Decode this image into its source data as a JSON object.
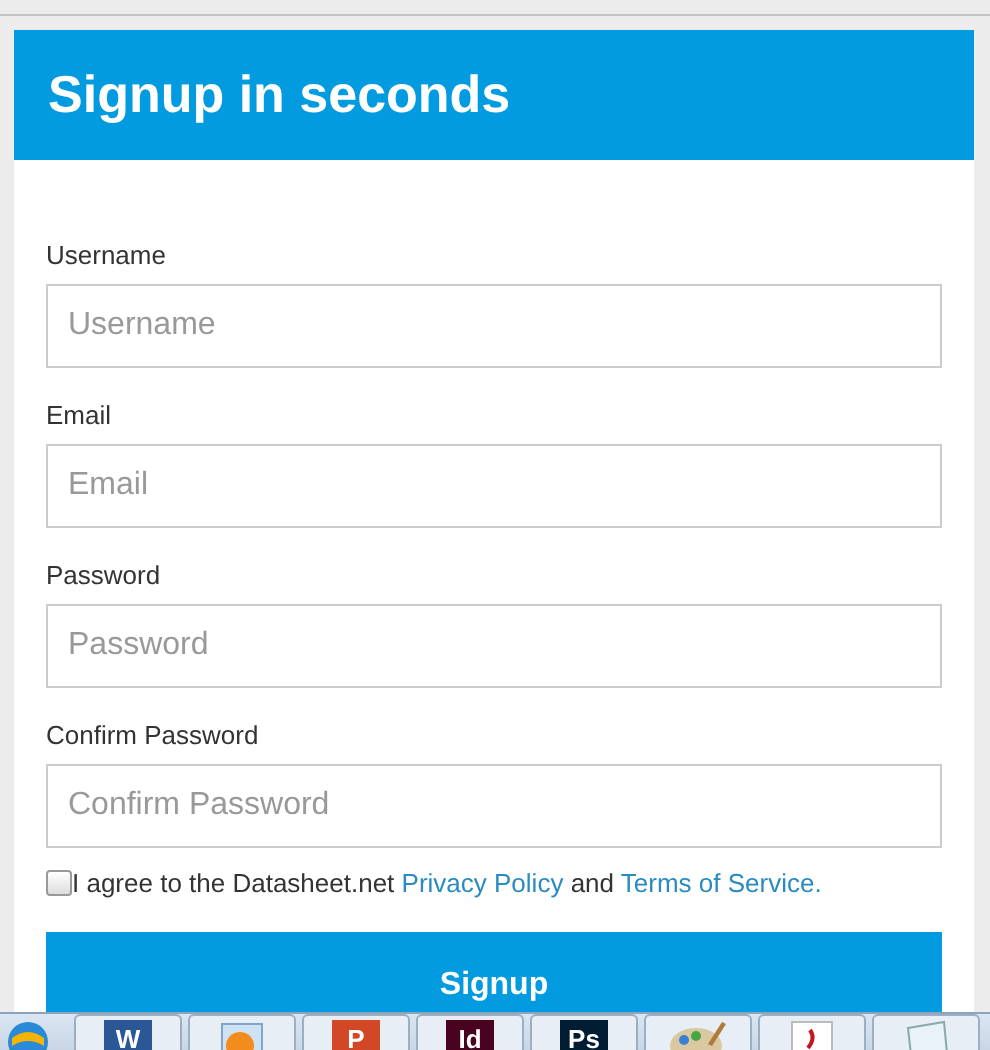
{
  "header": {
    "title": "Signup in seconds"
  },
  "fields": [
    {
      "label": "Username",
      "placeholder": "Username"
    },
    {
      "label": "Email",
      "placeholder": "Email"
    },
    {
      "label": "Password",
      "placeholder": "Password"
    },
    {
      "label": "Confirm Password",
      "placeholder": "Confirm Password"
    }
  ],
  "agreement": {
    "checked": false,
    "before": "I agree to the Datasheet.net",
    "link_1": "Privacy Policy",
    "middle": "and",
    "link_2": "Terms of Service."
  },
  "submit": {
    "label": "Signup"
  },
  "taskbar": [
    {
      "kind": "globe"
    },
    {
      "kind": "tile",
      "label": "W",
      "color": "#2b5797"
    },
    {
      "kind": "media"
    },
    {
      "kind": "tile",
      "label": "P",
      "color": "#d24726"
    },
    {
      "kind": "tile",
      "label": "Id",
      "color": "#49021f"
    },
    {
      "kind": "tile",
      "label": "Ps",
      "color": "#001d34"
    },
    {
      "kind": "palette"
    },
    {
      "kind": "document"
    },
    {
      "kind": "notepad"
    }
  ]
}
